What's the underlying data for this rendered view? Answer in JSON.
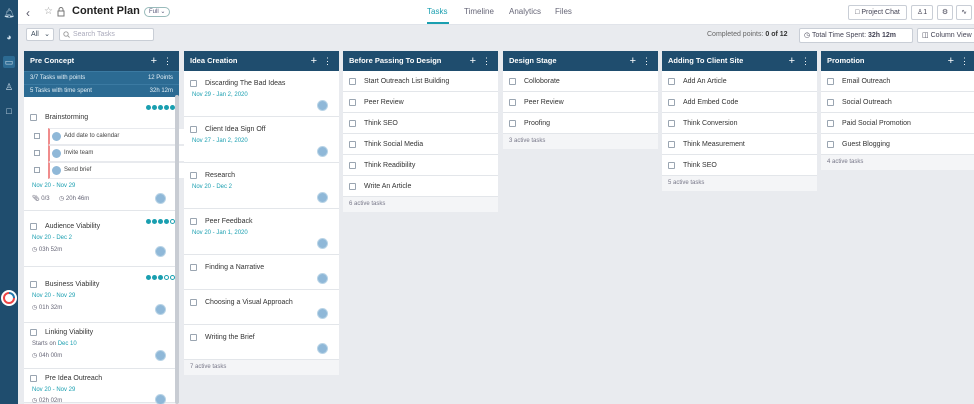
{
  "project": {
    "title": "Content Plan",
    "badge": "Full"
  },
  "tabs": [
    {
      "label": "Tasks",
      "active": true
    },
    {
      "label": "Timeline",
      "active": false
    },
    {
      "label": "Analytics",
      "active": false
    },
    {
      "label": "Files",
      "active": false
    }
  ],
  "toolbar": {
    "project_chat": "Project Chat",
    "members_count": "1"
  },
  "filters": {
    "view_select": "All",
    "search_placeholder": "Search Tasks",
    "completed_label": "Completed points:",
    "completed_value": "0 of 12",
    "time_label": "Total Time Spent:",
    "time_value": "32h 12m",
    "column_view": "Column View"
  },
  "columns": [
    {
      "title": "Pre Concept",
      "stats": [
        {
          "left": "3/7 Tasks with points",
          "right": "12 Points"
        },
        {
          "left": "5 Tasks with time spent",
          "right": "32h 12m"
        }
      ],
      "tasks": [
        {
          "title": "Brainstorming",
          "dates": "Nov 20 - Nov 29",
          "progress_filled": 5,
          "progress_total": 5,
          "subtasks": [
            "Add date to calendar",
            "Invite team",
            "Send brief"
          ],
          "checklist": "0/3",
          "time": "20h 46m"
        },
        {
          "title": "Audience Viability",
          "dates": "Nov 20 - Dec 2",
          "progress_filled": 4,
          "progress_total": 5,
          "time": "03h 52m"
        },
        {
          "title": "Business Viability",
          "dates": "Nov 20 - Nov 29",
          "progress_filled": 3,
          "progress_total": 5,
          "time": "01h 32m"
        },
        {
          "title": "Linking Viability",
          "starts_label": "Starts on",
          "starts_date": "Dec 10",
          "time": "04h 00m"
        },
        {
          "title": "Pre Idea Outreach",
          "dates": "Nov 20 - Nov 29",
          "time": "02h 02m"
        }
      ]
    },
    {
      "title": "Idea Creation",
      "tasks": [
        {
          "title": "Discarding The Bad Ideas",
          "dates": "Nov 29 - Jan 2, 2020"
        },
        {
          "title": "Client Idea Sign Off",
          "dates": "Nov 27 - Jan 2, 2020"
        },
        {
          "title": "Research",
          "dates": "Nov 20 - Dec 2"
        },
        {
          "title": "Peer Feedback",
          "dates": "Nov 20 - Jan 1, 2020"
        },
        {
          "title": "Finding a Narrative"
        },
        {
          "title": "Choosing a Visual Approach"
        },
        {
          "title": "Writing the Brief"
        }
      ],
      "footer": "7 active tasks"
    },
    {
      "title": "Before Passing To Design",
      "tasks": [
        "Start Outreach List Building",
        "Peer Review",
        "Think SEO",
        "Think Social Media",
        "Think Readibility",
        "Write An Article"
      ],
      "footer": "6 active tasks"
    },
    {
      "title": "Design Stage",
      "tasks": [
        "Colloborate",
        "Peer Review",
        "Proofing"
      ],
      "footer": "3 active tasks"
    },
    {
      "title": "Adding To Client Site",
      "tasks": [
        "Add An Article",
        "Add Embed Code",
        "Think Conversion",
        "Think Measurement",
        "Think SEO"
      ],
      "footer": "5 active tasks"
    },
    {
      "title": "Promotion",
      "tasks": [
        "Email Outreach",
        "Social Outreach",
        "Paid Social Promotion",
        "Guest Blogging"
      ],
      "footer": "4 active tasks"
    }
  ],
  "colors": {
    "header": "#1f4d6e",
    "accent": "#1a9fb0",
    "rail": "#1f4d6e"
  }
}
